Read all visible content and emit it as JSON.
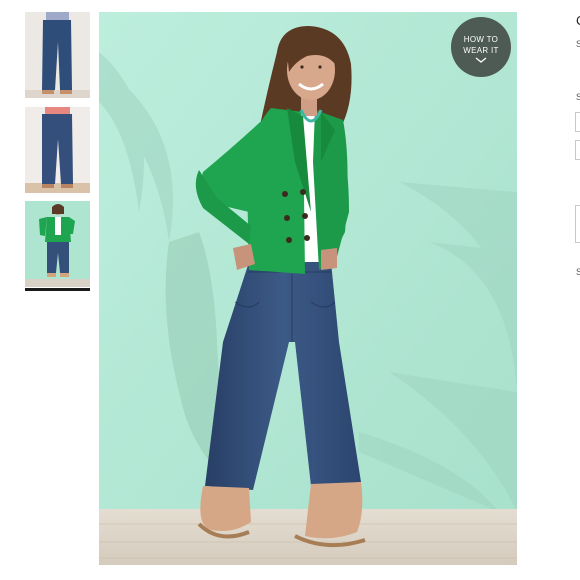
{
  "thumbnails": [
    {
      "alt": "jeans-front"
    },
    {
      "alt": "jeans-back"
    },
    {
      "alt": "outfit-full"
    }
  ],
  "selected_thumbnail_index": 2,
  "main_image": {
    "subject": "model in green jacket and cropped jeans"
  },
  "how_to_wear": {
    "line1": "HOW TO",
    "line2": "WEAR IT",
    "icon": "chevron-down-icon"
  },
  "right_panel": {
    "title_glyph": "C",
    "subtitle_glyph": "S",
    "size_label_glyph": "S",
    "footer_glyph": "S"
  },
  "colors": {
    "background_mint": "#aee5d1",
    "jacket_green": "#1fa44f",
    "denim": "#34507a",
    "badge": "#4e5a54"
  }
}
